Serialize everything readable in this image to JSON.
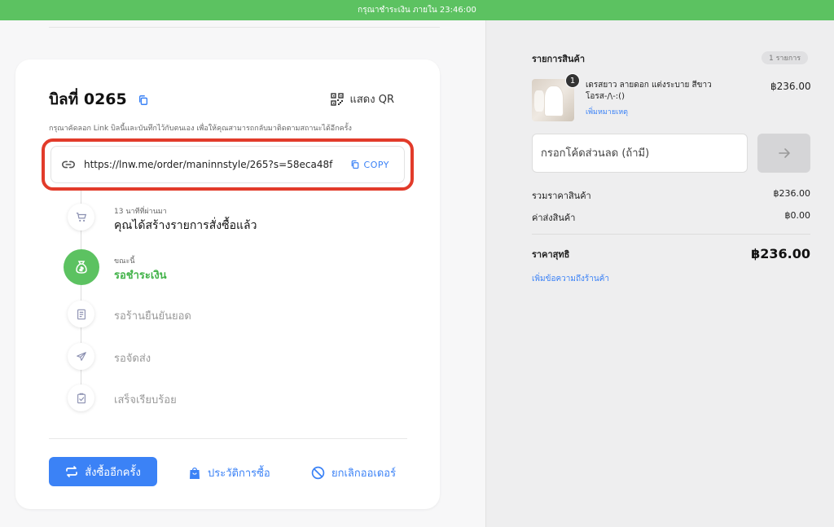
{
  "topbar": {
    "text": "กรุณาชำระเงิน ภายใน 23:46:00"
  },
  "bill": {
    "title": "บิลที่ 0265",
    "qr_label": "แสดง QR",
    "hint": "กรุณาคัดลอก Link บิลนี้และบันทึกไว้กับตนเอง เพื่อให้คุณสามารถกลับมาติดตามสถานะได้อีกครั้ง",
    "link": "https://lnw.me/order/maninnstyle/265?s=58eca48f",
    "copy_label": "COPY"
  },
  "timeline": [
    {
      "sub": "13 นาทีที่ผ่านมา",
      "label": "คุณได้สร้างรายการสั่งซื้อแล้ว",
      "icon": "cart-icon",
      "state": "done"
    },
    {
      "sub": "ขณะนี้",
      "label": "รอชำระเงิน",
      "icon": "money-bag-icon",
      "state": "active"
    },
    {
      "sub": "",
      "label": "รอร้านยืนยันยอด",
      "icon": "receipt-icon",
      "state": "pending"
    },
    {
      "sub": "",
      "label": "รอจัดส่ง",
      "icon": "plane-icon",
      "state": "pending"
    },
    {
      "sub": "",
      "label": "เสร็จเรียบร้อย",
      "icon": "clipboard-check-icon",
      "state": "pending"
    }
  ],
  "actions": {
    "reorder": "สั่งซื้ออีกครั้ง",
    "history": "ประวัติการซื้อ",
    "cancel": "ยกเลิกออเดอร์"
  },
  "summary": {
    "items_title": "รายการสินค้า",
    "items_count": "1 รายการ",
    "item": {
      "name": "เดรสยาว ลายดอก แต่งระบาย สีขาว โอรส-/\\-:()",
      "note_link": "เพิ่มหมายเหตุ",
      "price": "฿236.00",
      "qty": "1"
    },
    "discount_placeholder": "กรอกโค้ดส่วนลด (ถ้ามี)",
    "subtotal_label": "รวมราคาสินค้า",
    "subtotal_value": "฿236.00",
    "shipping_label": "ค่าส่งสินค้า",
    "shipping_value": "฿0.00",
    "net_label": "ราคาสุทธิ",
    "net_value": "฿236.00",
    "message_link": "เพิ่มข้อความถึงร้านค้า"
  },
  "colors": {
    "accent": "#3b82f6",
    "success": "#5cc261",
    "highlight": "#e23b2a"
  }
}
